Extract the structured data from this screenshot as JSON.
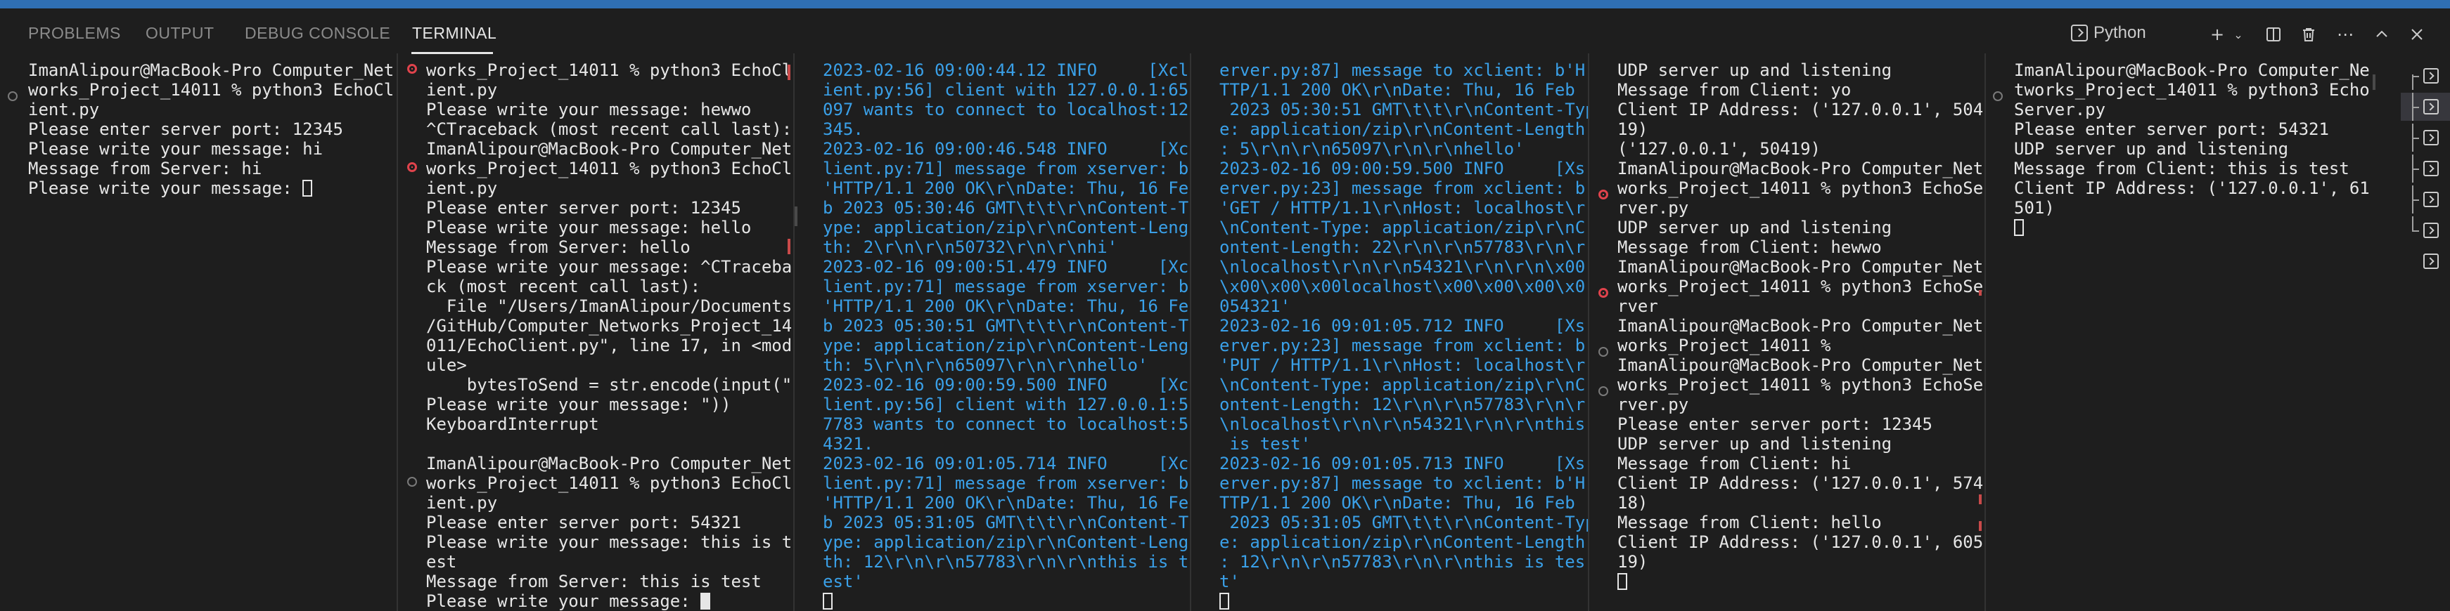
{
  "panel": {
    "tabs": [
      "PROBLEMS",
      "OUTPUT",
      "DEBUG CONSOLE",
      "TERMINAL"
    ],
    "active_tab": "TERMINAL",
    "profile": "Python",
    "actions": [
      "new-terminal",
      "launch-profile-dropdown",
      "split-terminal",
      "kill-terminal",
      "more-actions",
      "maximize-panel",
      "close-panel"
    ]
  },
  "terminals": [
    {
      "name": "terminal-1",
      "lines": [
        "ImanAlipour@MacBook-Pro Computer_Net",
        "works_Project_14011 % python3 EchoCl",
        "ient.py",
        "Please enter server port: 12345",
        "Please write your message: hi",
        "Message from Server: hi",
        "Please write your message: "
      ]
    },
    {
      "name": "terminal-2",
      "lines": [
        "works_Project_14011 % python3 EchoCl",
        "ient.py",
        "Please write your message: hewwo",
        "^CTraceback (most recent call last):",
        "ImanAlipour@MacBook-Pro Computer_Net",
        "works_Project_14011 % python3 EchoCl",
        "ient.py",
        "Please enter server port: 12345",
        "Please write your message: hello",
        "Message from Server: hello",
        "Please write your message: ^CTraceba",
        "ck (most recent call last):",
        "  File \"/Users/ImanAlipour/Documents",
        "/GitHub/Computer_Networks_Project_14",
        "011/EchoClient.py\", line 17, in <mod",
        "ule>",
        "    bytesToSend = str.encode(input(\"",
        "Please write your message: \"))",
        "KeyboardInterrupt",
        "",
        "ImanAlipour@MacBook-Pro Computer_Net",
        "works_Project_14011 % python3 EchoCl",
        "ient.py",
        "Please enter server port: 54321",
        "Please write your message: this is t",
        "est",
        "Message from Server: this is test",
        "Please write your message: "
      ]
    },
    {
      "name": "terminal-3",
      "lines": [
        "2023-02-16 09:00:44.12 INFO     [Xcl",
        "ient.py:56] client with 127.0.0.1:65",
        "097 wants to connect to localhost:12",
        "345.",
        "2023-02-16 09:00:46.548 INFO     [Xc",
        "lient.py:71] message from xserver: b",
        "'HTTP/1.1 200 OK\\r\\nDate: Thu, 16 Fe",
        "b 2023 05:30:46 GMT\\t\\t\\r\\nContent-T",
        "ype: application/zip\\r\\nContent-Leng",
        "th: 2\\r\\n\\r\\n50732\\r\\n\\r\\nhi'",
        "2023-02-16 09:00:51.479 INFO     [Xc",
        "lient.py:71] message from xserver: b",
        "'HTTP/1.1 200 OK\\r\\nDate: Thu, 16 Fe",
        "b 2023 05:30:51 GMT\\t\\t\\r\\nContent-T",
        "ype: application/zip\\r\\nContent-Leng",
        "th: 5\\r\\n\\r\\n65097\\r\\n\\r\\nhello'",
        "2023-02-16 09:00:59.500 INFO     [Xc",
        "lient.py:56] client with 127.0.0.1:5",
        "7783 wants to connect to localhost:5",
        "4321.",
        "2023-02-16 09:01:05.714 INFO     [Xc",
        "lient.py:71] message from xserver: b",
        "'HTTP/1.1 200 OK\\r\\nDate: Thu, 16 Fe",
        "b 2023 05:31:05 GMT\\t\\t\\r\\nContent-T",
        "ype: application/zip\\r\\nContent-Leng",
        "th: 12\\r\\n\\r\\n57783\\r\\n\\r\\nthis is t",
        "est'",
        ""
      ]
    },
    {
      "name": "terminal-4",
      "lines": [
        "erver.py:87] message to xclient: b'H",
        "TTP/1.1 200 OK\\r\\nDate: Thu, 16 Feb",
        " 2023 05:30:51 GMT\\t\\t\\r\\nContent-Typ",
        "e: application/zip\\r\\nContent-Length",
        ": 5\\r\\n\\r\\n65097\\r\\n\\r\\nhello'",
        "2023-02-16 09:00:59.500 INFO     [Xs",
        "erver.py:23] message from xclient: b",
        "'GET / HTTP/1.1\\r\\nHost: localhost\\r",
        "\\nContent-Type: application/zip\\r\\nC",
        "ontent-Length: 22\\r\\n\\r\\n57783\\r\\n\\r",
        "\\nlocalhost\\r\\n\\r\\n54321\\r\\n\\r\\n\\x00",
        "\\x00\\x00\\x00localhost\\x00\\x00\\x00\\x0",
        "054321'",
        "2023-02-16 09:01:05.712 INFO     [Xs",
        "erver.py:23] message from xclient: b",
        "'PUT / HTTP/1.1\\r\\nHost: localhost\\r",
        "\\nContent-Type: application/zip\\r\\nC",
        "ontent-Length: 12\\r\\n\\r\\n57783\\r\\n\\r",
        "\\nlocalhost\\r\\n\\r\\n54321\\r\\n\\r\\nthis",
        " is test'",
        "2023-02-16 09:01:05.713 INFO     [Xs",
        "erver.py:87] message to xclient: b'H",
        "TTP/1.1 200 OK\\r\\nDate: Thu, 16 Feb",
        " 2023 05:31:05 GMT\\t\\t\\r\\nContent-Typ",
        "e: application/zip\\r\\nContent-Length",
        ": 12\\r\\n\\r\\n57783\\r\\n\\r\\nthis is tes",
        "t'",
        ""
      ]
    },
    {
      "name": "terminal-5",
      "lines": [
        "UDP server up and listening",
        "Message from Client: yo",
        "Client IP Address: ('127.0.0.1', 504",
        "19)",
        "('127.0.0.1', 50419)",
        "ImanAlipour@MacBook-Pro Computer_Net",
        "works_Project_14011 % python3 EchoSe",
        "rver.py",
        "UDP server up and listening",
        "Message from Client: hewwo",
        "ImanAlipour@MacBook-Pro Computer_Net",
        "works_Project_14011 % python3 EchoSe",
        "rver",
        "ImanAlipour@MacBook-Pro Computer_Net",
        "works_Project_14011 %",
        "ImanAlipour@MacBook-Pro Computer_Net",
        "works_Project_14011 % python3 EchoSe",
        "rver.py",
        "Please enter server port: 12345",
        "UDP server up and listening",
        "Message from Client: hi",
        "Client IP Address: ('127.0.0.1', 574",
        "18)",
        "Message from Client: hello",
        "Client IP Address: ('127.0.0.1', 605",
        "19)",
        ""
      ]
    },
    {
      "name": "terminal-6",
      "lines": [
        "ImanAlipour@MacBook-Pro Computer_Ne",
        "tworks_Project_14011 % python3 Echo",
        "Server.py",
        "Please enter server port: 54321",
        "UDP server up and listening",
        "Message from Client: this is test",
        "Client IP Address: ('127.0.0.1', 61",
        "501)",
        ""
      ]
    }
  ]
}
